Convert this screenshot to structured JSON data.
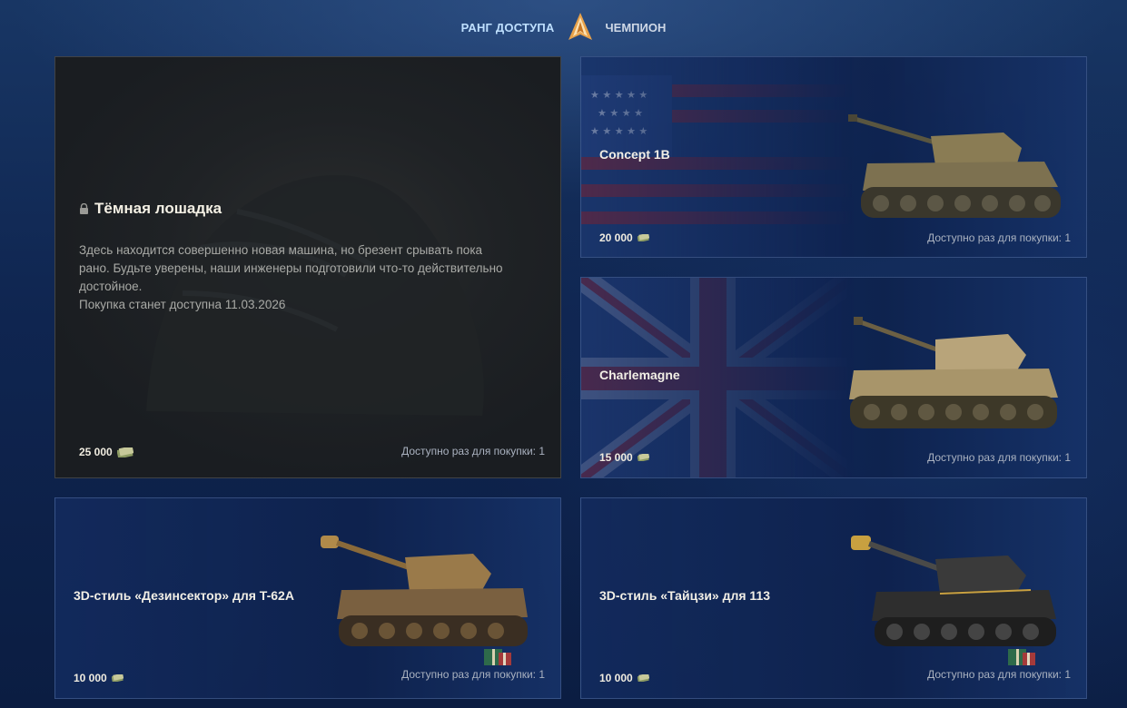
{
  "header": {
    "rank_label": "РАНГ ДОСТУПА",
    "rank_value": "ЧЕМПИОН"
  },
  "colors": {
    "background": "#0f2550",
    "accent": "#bfe0ff",
    "emblem": "#e8a24a"
  },
  "dark_horse": {
    "title": "Тёмная лошадка",
    "description_lines": [
      "Здесь находится совершенно новая машина, но брезент срывать пока",
      "рано. Будьте уверены, наши инженеры подготовили что-то действительно",
      "достойное.",
      "Покупка станет доступна 11.03.2026"
    ],
    "price": "25 000",
    "availability": "Доступно раз для покупки: 1",
    "icon": "lock-icon"
  },
  "cards": {
    "concept": {
      "title": "Concept 1B",
      "price": "20 000",
      "availability": "Доступно раз для покупки: 1",
      "flag": "usa"
    },
    "charlemagne": {
      "title": "Charlemagne",
      "price": "15 000",
      "availability": "Доступно раз для покупки: 1",
      "flag": "uk"
    },
    "style_t62a": {
      "title": "3D-стиль «Дезинсектор» для T-62A",
      "price": "10 000",
      "availability": "Доступно раз для покупки: 1",
      "icon": "gift-icon"
    },
    "style_113": {
      "title": "3D-стиль «Тайцзи» для 113",
      "price": "10 000",
      "availability": "Доступно раз для покупки: 1",
      "icon": "gift-icon"
    }
  }
}
